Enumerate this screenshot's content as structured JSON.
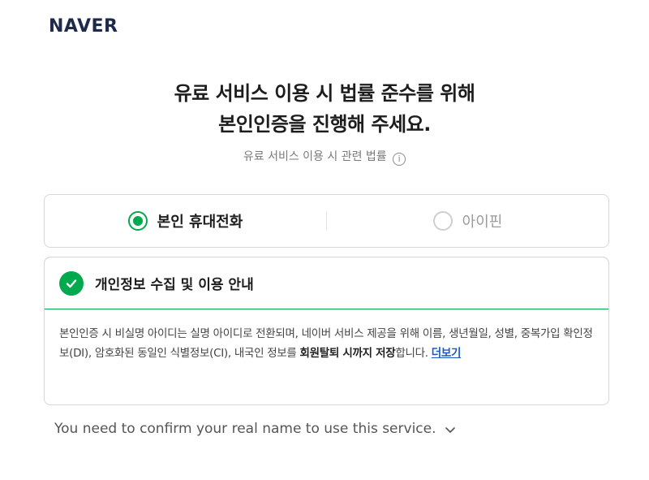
{
  "header": {
    "logo": "NAVER"
  },
  "headline": {
    "line1": "유료 서비스 이용 시 법률 준수를 위해",
    "line2": "본인인증을 진행해 주세요."
  },
  "subtext": {
    "label": "유료 서비스 이용 시 관련 법률",
    "icon": "info-icon"
  },
  "auth_methods": [
    {
      "label": "본인 휴대전화",
      "selected": true
    },
    {
      "label": "아이핀",
      "selected": false
    }
  ],
  "privacy": {
    "title": "개인정보 수집 및 이용 안내",
    "body_text": "본인인증 시 비실명 아이디는 실명 아이디로 전환되며, 네이버 서비스 제공을 위해 이름, 생년월일, 성별, 중복가입 확인정보(DI), 암호화된 동일인 식별정보(CI), 내국인 정보를 ",
    "body_bold": "회원탈퇴 시까지 저장",
    "body_tail": "합니다. ",
    "more_link": "더보기"
  },
  "english_notice": {
    "text": "You need to confirm your real name to use this service.",
    "icon": "chevron-down-icon"
  },
  "colors": {
    "accent": "#03a94d",
    "link": "#1b59c7",
    "logo": "#1e2a4a"
  }
}
